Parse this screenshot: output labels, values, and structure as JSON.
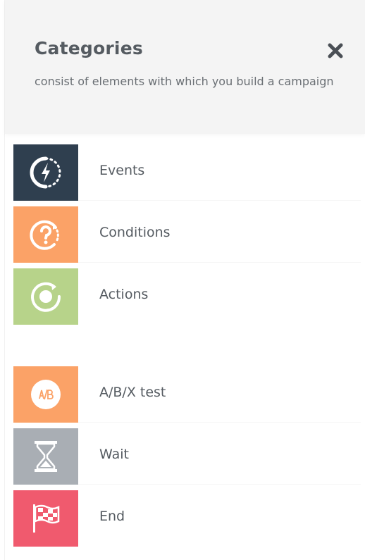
{
  "header": {
    "title": "Categories",
    "subtitle": "consist of elements with which you build a campaign",
    "close_icon": "close-icon"
  },
  "categories": [
    {
      "label": "Events",
      "icon": "lightning-icon",
      "color": "#2f3f4f"
    },
    {
      "label": "Conditions",
      "icon": "question-cycle-icon",
      "color": "#fba267"
    },
    {
      "label": "Actions",
      "icon": "action-cycle-icon",
      "color": "#b7d38a"
    },
    {
      "label": "A/B/X test",
      "icon": "ab-test-icon",
      "color": "#fba267"
    },
    {
      "label": "Wait",
      "icon": "hourglass-icon",
      "color": "#a9aeb4"
    },
    {
      "label": "End",
      "icon": "checkered-flag-icon",
      "color": "#f05a6e"
    }
  ],
  "colors": {
    "header_bg": "#f4f4f4",
    "text": "#555b61"
  }
}
